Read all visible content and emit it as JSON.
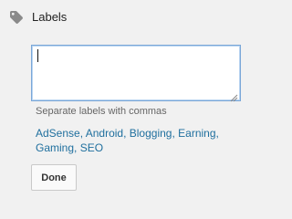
{
  "header": {
    "title": "Labels",
    "icon": "tag-icon"
  },
  "labels_input": {
    "value": "",
    "placeholder": "",
    "resize_icon": "resize-grip-icon"
  },
  "helper": {
    "text": "Separate labels with commas"
  },
  "suggestions": {
    "items": [
      "AdSense",
      "Android",
      "Blogging",
      "Earning",
      "Gaming",
      "SEO"
    ],
    "separator": ", "
  },
  "done_button": {
    "label": "Done"
  },
  "colors": {
    "background": "#f1f1f1",
    "link": "#1f6f9e",
    "helper_text": "#666666",
    "input_border_focus": "#7aa7d8",
    "icon_gray": "#8a8a8a"
  }
}
